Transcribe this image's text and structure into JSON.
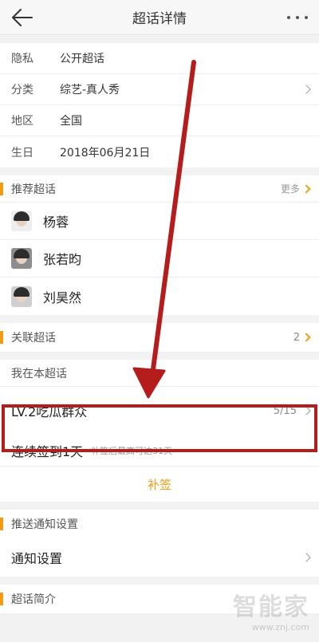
{
  "header": {
    "title": "超话详情"
  },
  "info": [
    {
      "key": "隐私",
      "value": "公开超话",
      "chevron": false
    },
    {
      "key": "分类",
      "value": "综艺-真人秀",
      "chevron": true
    },
    {
      "key": "地区",
      "value": "全国",
      "chevron": false
    },
    {
      "key": "生日",
      "value": "2018年06月21日",
      "chevron": false
    }
  ],
  "recommended": {
    "title": "推荐超话",
    "more": "更多",
    "people": [
      {
        "name": "杨蓉"
      },
      {
        "name": "张若昀"
      },
      {
        "name": "刘昊然"
      }
    ]
  },
  "related": {
    "title": "关联超话",
    "count": "2"
  },
  "mine": {
    "title": "我在本超话",
    "level": "LV.2吃瓜群众",
    "progress": "5/15",
    "sign_in": "连续签到1天",
    "sign_hint": "补签后最高可达31天",
    "resign": "补签"
  },
  "push": {
    "title": "推送通知设置",
    "item": "通知设置"
  },
  "intro": {
    "title": "超话简介"
  },
  "watermark": {
    "big": "智能家",
    "small": "www.znj.com"
  },
  "colors": {
    "accent": "#f39c12",
    "highlight": "#b51c1c"
  }
}
